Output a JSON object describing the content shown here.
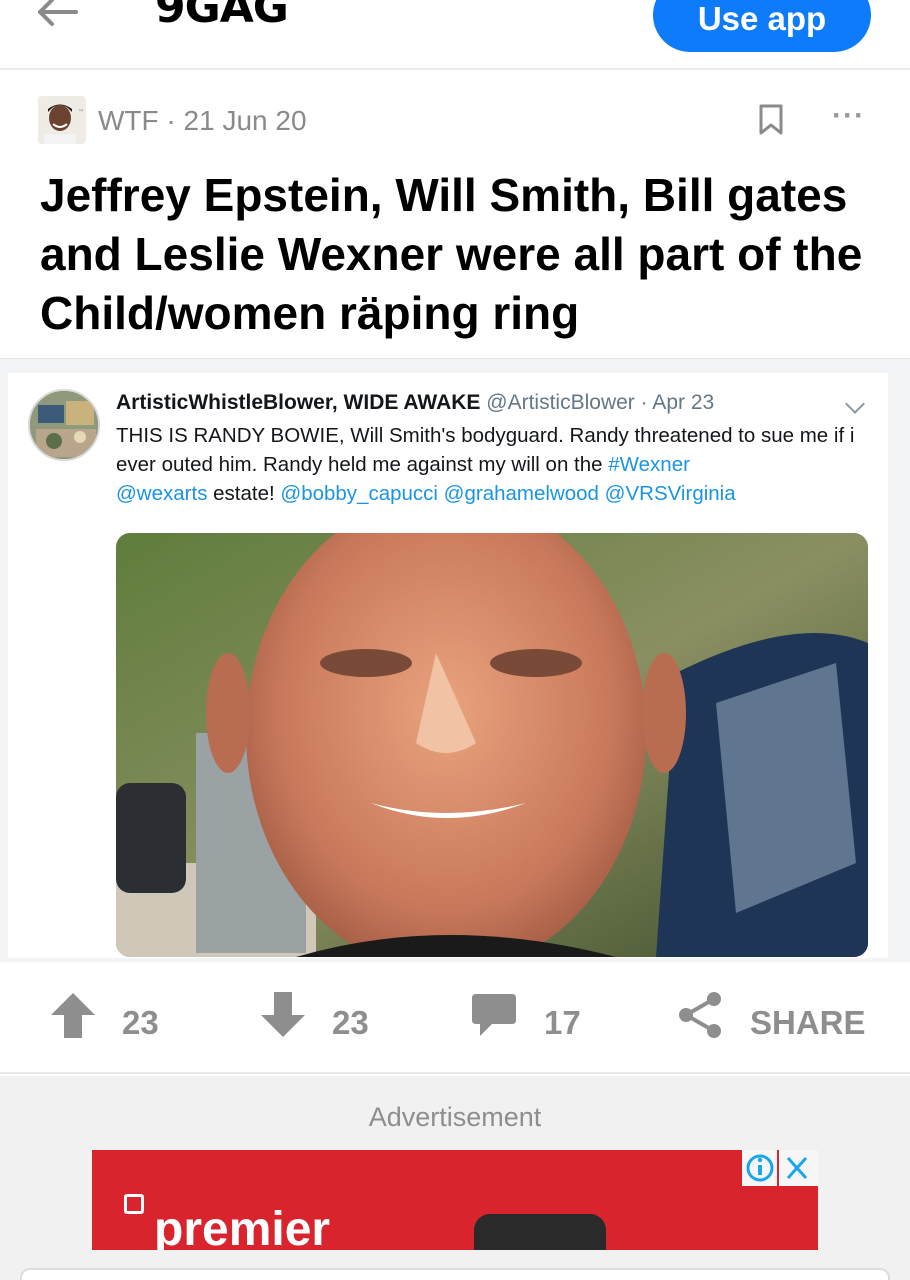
{
  "header": {
    "logo": "9GAG",
    "use_app_label": "Use app"
  },
  "post": {
    "section": "WTF",
    "separator": "·",
    "date": "21 Jun 20",
    "title": "Jeffrey Epstein, Will Smith, Bill gates and Leslie Wexner were all part of the Child/women räping ring",
    "more_label": "···"
  },
  "tweet": {
    "display_name": "ArtisticWhistleBlower, WIDE AWAKE",
    "handle": "@ArtisticBlower",
    "date": "· Apr 23",
    "text_1": "THIS IS RANDY BOWIE, Will Smith's bodyguard. Randy threatened to sue me if i ever outed him. Randy held me against my will on the ",
    "hashtag": "#Wexner",
    "mention_1": "@wexarts",
    "text_2": " estate! ",
    "mention_2": "@bobby_capucci",
    "mention_3": "@grahamelwood",
    "mention_4": "@VRSVirginia"
  },
  "actions": {
    "upvotes": "23",
    "downvotes": "23",
    "comments": "17",
    "share_label": "SHARE"
  },
  "ad": {
    "label": "Advertisement",
    "brand": "premier"
  },
  "colors": {
    "accent": "#0e7bfb",
    "tweet_link": "#1b95e0",
    "ad_red": "#d9232d"
  }
}
